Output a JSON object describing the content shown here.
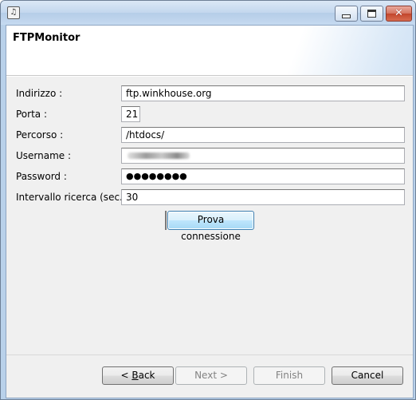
{
  "window": {
    "title": "",
    "app_icon": "app-icon",
    "controls": [
      "minimize-icon",
      "maximize-icon",
      "close-icon"
    ]
  },
  "header": {
    "title": "FTPMonitor"
  },
  "form": {
    "address_label": "Indirizzo :",
    "address_value": "ftp.winkhouse.org",
    "port_label": "Porta :",
    "port_value": "21",
    "path_label": "Percorso :",
    "path_value": "/htdocs/",
    "username_label": "Username :",
    "username_value": "",
    "password_label": "Password :",
    "password_value": "●●●●●●●●",
    "interval_label": "Intervallo ricerca (sec.) :",
    "interval_value": "30",
    "test_button": "Prova connessione"
  },
  "footer": {
    "back_prefix": "< ",
    "back_key": "B",
    "back_rest": "ack",
    "next": "Next >",
    "finish": "Finish",
    "cancel": "Cancel"
  }
}
